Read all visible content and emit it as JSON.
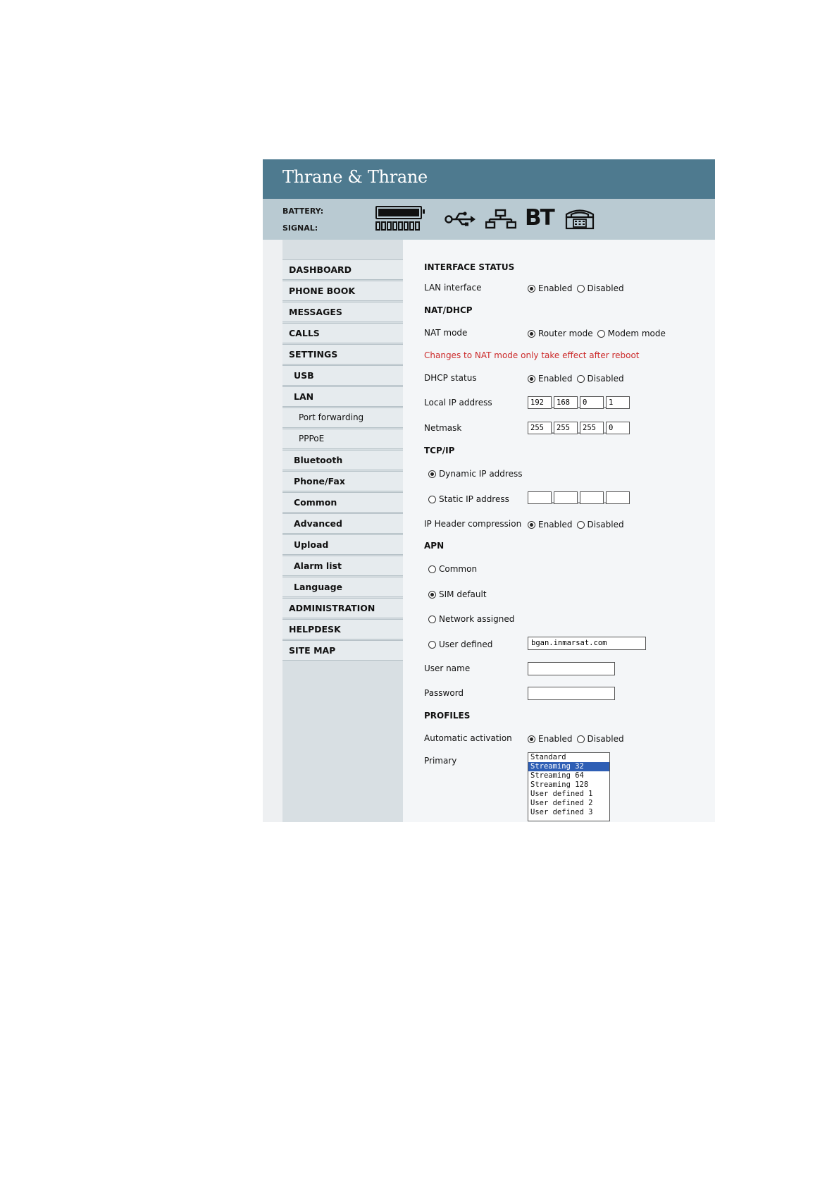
{
  "header": {
    "brand": "Thrane & Thrane",
    "battery_label": "BATTERY:",
    "signal_label": "SIGNAL:",
    "battery_level": 1.0,
    "signal_bars_total": 8,
    "interface_icons": [
      "usb-icon",
      "lan-icon",
      "bluetooth-icon",
      "phone-fax-icon"
    ],
    "bluetooth_glyph": "BT"
  },
  "sidebar": {
    "items": [
      {
        "label": "DASHBOARD",
        "level": 0
      },
      {
        "label": "PHONE BOOK",
        "level": 0
      },
      {
        "label": "MESSAGES",
        "level": 0
      },
      {
        "label": "CALLS",
        "level": 0
      },
      {
        "label": "SETTINGS",
        "level": 0
      },
      {
        "label": "USB",
        "level": 1
      },
      {
        "label": "LAN",
        "level": 1
      },
      {
        "label": "Port forwarding",
        "level": 2
      },
      {
        "label": "PPPoE",
        "level": 2
      },
      {
        "label": "Bluetooth",
        "level": 1
      },
      {
        "label": "Phone/Fax",
        "level": 1
      },
      {
        "label": "Common",
        "level": 1
      },
      {
        "label": "Advanced",
        "level": 1
      },
      {
        "label": "Upload",
        "level": 1
      },
      {
        "label": "Alarm list",
        "level": 1
      },
      {
        "label": "Language",
        "level": 1
      },
      {
        "label": "ADMINISTRATION",
        "level": 0
      },
      {
        "label": "HELPDESK",
        "level": 0
      },
      {
        "label": "SITE MAP",
        "level": 0
      }
    ]
  },
  "form": {
    "interface_status": {
      "title": "INTERFACE STATUS",
      "lan_interface": {
        "label": "LAN interface",
        "options": [
          "Enabled",
          "Disabled"
        ],
        "selected": "Enabled"
      }
    },
    "nat_dhcp": {
      "title": "NAT/DHCP",
      "nat_mode": {
        "label": "NAT mode",
        "options": [
          "Router mode",
          "Modem mode"
        ],
        "selected": "Router mode"
      },
      "warning": "Changes to NAT mode only take effect after reboot",
      "dhcp_status": {
        "label": "DHCP status",
        "options": [
          "Enabled",
          "Disabled"
        ],
        "selected": "Enabled"
      },
      "local_ip": {
        "label": "Local IP address",
        "octets": [
          "192",
          "168",
          "0",
          "1"
        ]
      },
      "netmask": {
        "label": "Netmask",
        "octets": [
          "255",
          "255",
          "255",
          "0"
        ]
      }
    },
    "tcp_ip": {
      "title": "TCP/IP",
      "dynamic_label": "Dynamic IP address",
      "static_label": "Static IP address",
      "selected": "dynamic",
      "static_octets": [
        "",
        "",
        "",
        ""
      ],
      "header_compression": {
        "label": "IP Header compression",
        "options": [
          "Enabled",
          "Disabled"
        ],
        "selected": "Enabled"
      }
    },
    "apn": {
      "title": "APN",
      "common_label": "Common",
      "sim_default_label": "SIM default",
      "network_assigned_label": "Network assigned",
      "user_defined_label": "User defined",
      "selected": "sim_default",
      "user_defined_value": "bgan.inmarsat.com",
      "username_label": "User name",
      "username_value": "",
      "password_label": "Password",
      "password_value": ""
    },
    "profiles": {
      "title": "PROFILES",
      "automatic_activation": {
        "label": "Automatic activation",
        "options": [
          "Enabled",
          "Disabled"
        ],
        "selected": "Enabled"
      },
      "primary_label": "Primary",
      "primary_options": [
        "Standard",
        "Streaming 32",
        "Streaming 64",
        "Streaming 128",
        "User defined 1",
        "User defined 2",
        "User defined 3"
      ],
      "primary_selected": "Streaming 32"
    }
  }
}
